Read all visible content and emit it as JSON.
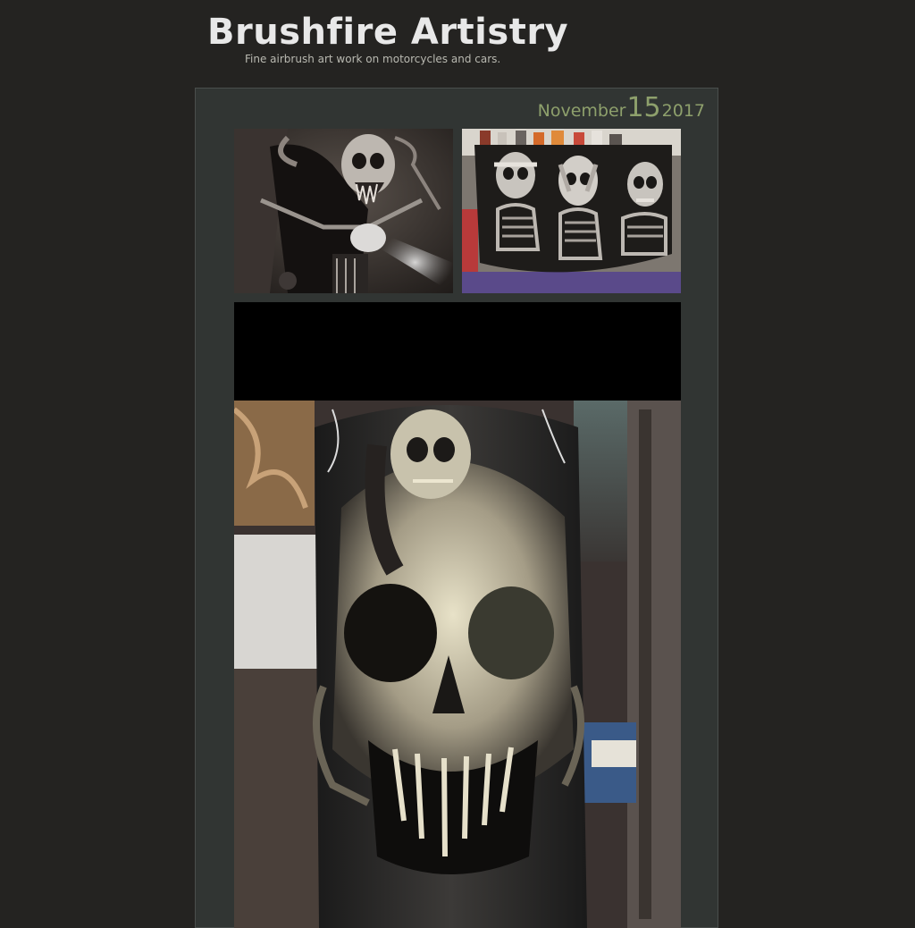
{
  "site": {
    "title": "Brushfire Artistry",
    "tagline": "Fine airbrush art work on motorcycles and cars."
  },
  "post": {
    "date": {
      "month": "November",
      "day": "15",
      "year": "2017"
    },
    "photos": [
      {
        "subject": "skeleton rider on motorcycle airbrush artwork"
      },
      {
        "subject": "three skeletons airbrushed panel"
      },
      {
        "subject": "large skull airbrushed fender"
      }
    ]
  },
  "colors": {
    "background": "#242321",
    "post_background": "#313533",
    "title": "#e8e8e8",
    "tagline": "#b9b9b1",
    "date_accent": "#8ea06c"
  }
}
